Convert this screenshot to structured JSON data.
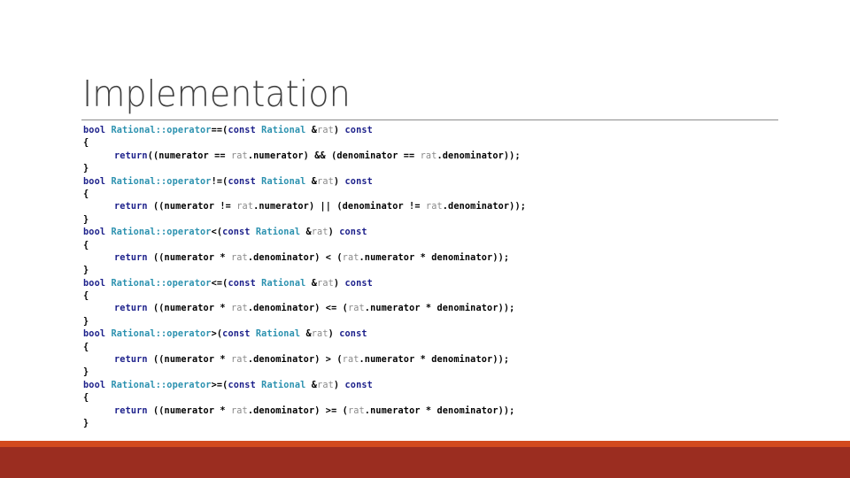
{
  "slide": {
    "title": "Implementation",
    "colors": {
      "keyword": "#1b1f8a",
      "type": "#2b91af",
      "parameter": "#8a8a8a",
      "accent_strip": "#d24a1e",
      "footer_bar": "#9b2d20"
    },
    "functions": [
      {
        "kw_bool": "bool",
        "class_name": "Rational",
        "scope": "::",
        "op_keyword": "operator",
        "op_symbol": "==",
        "open_paren": "(",
        "kw_const": "const",
        "param_type": "Rational",
        "amp": "&",
        "param": "rat",
        "close_paren": ")",
        "kw_const2": "const",
        "open_brace": "{",
        "body": {
          "kw_return": "return",
          "p1": "((numerator == ",
          "rat1": "rat",
          "p2": ".numerator) && (denominator == ",
          "rat2": "rat",
          "p3": ".denominator));"
        },
        "close_brace": "}"
      },
      {
        "kw_bool": "bool",
        "class_name": "Rational",
        "scope": "::",
        "op_keyword": "operator",
        "op_symbol": "!=",
        "open_paren": "(",
        "kw_const": "const",
        "param_type": "Rational",
        "amp": "&",
        "param": "rat",
        "close_paren": ")",
        "kw_const2": "const",
        "open_brace": "{",
        "body": {
          "kw_return": "return",
          "p1": " ((numerator != ",
          "rat1": "rat",
          "p2": ".numerator) || (denominator != ",
          "rat2": "rat",
          "p3": ".denominator));"
        },
        "close_brace": "}"
      },
      {
        "kw_bool": "bool",
        "class_name": "Rational",
        "scope": "::",
        "op_keyword": "operator",
        "op_symbol": "<",
        "open_paren": "(",
        "kw_const": "const",
        "param_type": "Rational",
        "amp": "&",
        "param": "rat",
        "close_paren": ")",
        "kw_const2": "const",
        "open_brace": "{",
        "body": {
          "kw_return": "return",
          "p1": " ((numerator * ",
          "rat1": "rat",
          "p2": ".denominator) < (",
          "rat2": "rat",
          "p3": ".numerator * denominator));"
        },
        "close_brace": "}"
      },
      {
        "kw_bool": "bool",
        "class_name": "Rational",
        "scope": "::",
        "op_keyword": "operator",
        "op_symbol": "<=",
        "open_paren": "(",
        "kw_const": "const",
        "param_type": "Rational",
        "amp": "&",
        "param": "rat",
        "close_paren": ")",
        "kw_const2": "const",
        "open_brace": "{",
        "body": {
          "kw_return": "return",
          "p1": " ((numerator * ",
          "rat1": "rat",
          "p2": ".denominator) <= (",
          "rat2": "rat",
          "p3": ".numerator * denominator));"
        },
        "close_brace": "}"
      },
      {
        "kw_bool": "bool",
        "class_name": "Rational",
        "scope": "::",
        "op_keyword": "operator",
        "op_symbol": ">",
        "open_paren": "(",
        "kw_const": "const",
        "param_type": "Rational",
        "amp": "&",
        "param": "rat",
        "close_paren": ")",
        "kw_const2": "const",
        "open_brace": "{",
        "body": {
          "kw_return": "return",
          "p1": " ((numerator * ",
          "rat1": "rat",
          "p2": ".denominator) > (",
          "rat2": "rat",
          "p3": ".numerator * denominator));"
        },
        "close_brace": "}"
      },
      {
        "kw_bool": "bool",
        "class_name": "Rational",
        "scope": "::",
        "op_keyword": "operator",
        "op_symbol": ">=",
        "open_paren": "(",
        "kw_const": "const",
        "param_type": "Rational",
        "amp": "&",
        "param": "rat",
        "close_paren": ")",
        "kw_const2": "const",
        "open_brace": "{",
        "body": {
          "kw_return": "return",
          "p1": " ((numerator * ",
          "rat1": "rat",
          "p2": ".denominator) >= (",
          "rat2": "rat",
          "p3": ".numerator * denominator));"
        },
        "close_brace": "}"
      }
    ]
  }
}
